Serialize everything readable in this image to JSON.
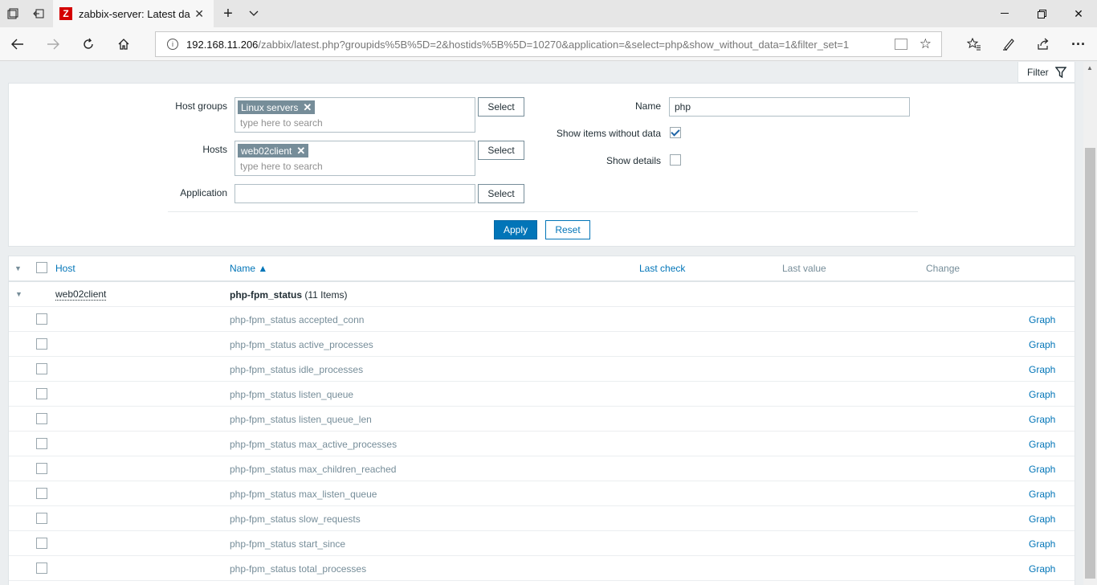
{
  "browser": {
    "tab_title": "zabbix-server: Latest da",
    "favicon_letter": "Z",
    "url_host": "192.168.11.206",
    "url_path": "/zabbix/latest.php?groupids%5B%5D=2&hostids%5B%5D=10270&application=&select=php&show_without_data=1&filter_set=1"
  },
  "filter": {
    "tab_label": "Filter",
    "host_groups_label": "Host groups",
    "host_groups_tag": "Linux servers",
    "hosts_label": "Hosts",
    "hosts_tag": "web02client",
    "search_placeholder": "type here to search",
    "application_label": "Application",
    "application_value": "",
    "select_label": "Select",
    "name_label": "Name",
    "name_value": "php",
    "show_without_data_label": "Show items without data",
    "show_without_data": true,
    "show_details_label": "Show details",
    "show_details": false,
    "apply_label": "Apply",
    "reset_label": "Reset"
  },
  "table": {
    "columns": {
      "host": "Host",
      "name": "Name ▲",
      "last_check": "Last check",
      "last_value": "Last value",
      "change": "Change"
    },
    "group": {
      "host": "web02client",
      "application": "php-fpm_status",
      "count": "(11 Items)"
    },
    "graph_label": "Graph",
    "rows": [
      "php-fpm_status accepted_conn",
      "php-fpm_status active_processes",
      "php-fpm_status idle_processes",
      "php-fpm_status listen_queue",
      "php-fpm_status listen_queue_len",
      "php-fpm_status max_active_processes",
      "php-fpm_status max_children_reached",
      "php-fpm_status max_listen_queue",
      "php-fpm_status slow_requests",
      "php-fpm_status start_since",
      "php-fpm_status total_processes"
    ]
  }
}
